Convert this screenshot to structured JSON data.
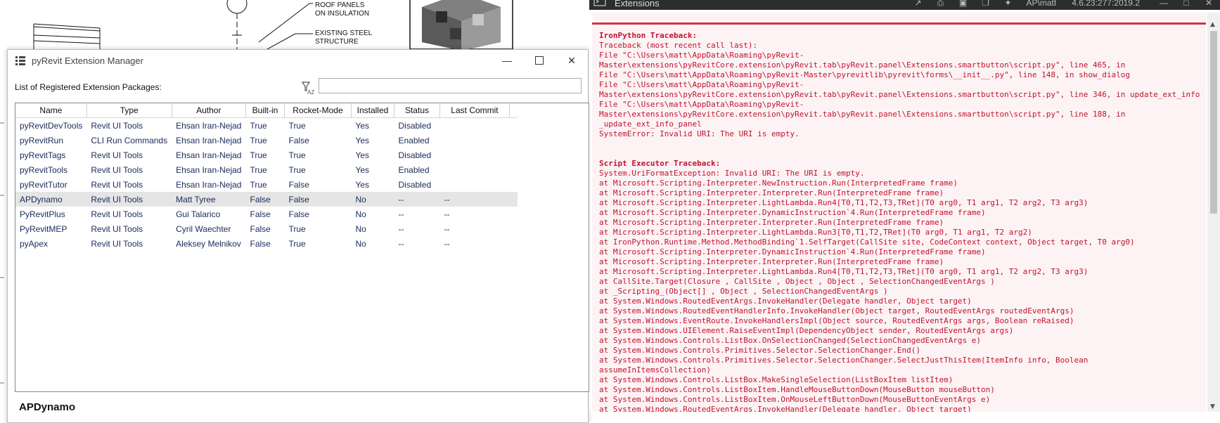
{
  "cad": {
    "label_roof_1": "ROOF PANELS",
    "label_roof_2": "ON INSULATION",
    "label_steel_1": "EXISTING STEEL",
    "label_steel_2": "STRUCTURE"
  },
  "manager": {
    "title": "pyRevit Extension Manager",
    "list_label": "List of Registered Extension Packages:",
    "search_value": "",
    "columns": [
      "Name",
      "Type",
      "Author",
      "Built-in",
      "Rocket-Mode",
      "Installed",
      "Status",
      "Last Commit"
    ],
    "rows": [
      {
        "name": "pyRevitDevTools",
        "type": "Revit UI Tools",
        "author": "Ehsan Iran-Nejad",
        "builtin": "True",
        "rocket": "True",
        "installed": "Yes",
        "status": "Disabled",
        "commit": ""
      },
      {
        "name": "pyRevitRun",
        "type": "CLI Run Commands",
        "author": "Ehsan Iran-Nejad",
        "builtin": "True",
        "rocket": "False",
        "installed": "Yes",
        "status": "Enabled",
        "commit": ""
      },
      {
        "name": "pyRevitTags",
        "type": "Revit UI Tools",
        "author": "Ehsan Iran-Nejad",
        "builtin": "True",
        "rocket": "True",
        "installed": "Yes",
        "status": "Disabled",
        "commit": ""
      },
      {
        "name": "pyRevitTools",
        "type": "Revit UI Tools",
        "author": "Ehsan Iran-Nejad",
        "builtin": "True",
        "rocket": "True",
        "installed": "Yes",
        "status": "Enabled",
        "commit": ""
      },
      {
        "name": "pyRevitTutor",
        "type": "Revit UI Tools",
        "author": "Ehsan Iran-Nejad",
        "builtin": "True",
        "rocket": "False",
        "installed": "Yes",
        "status": "Disabled",
        "commit": ""
      },
      {
        "name": "APDynamo",
        "type": "Revit UI Tools",
        "author": "Matt Tyree",
        "builtin": "False",
        "rocket": "False",
        "installed": "No",
        "status": "--",
        "commit": "--",
        "selected": true
      },
      {
        "name": "PyRevitPlus",
        "type": "Revit UI Tools",
        "author": "Gui Talarico",
        "builtin": "False",
        "rocket": "False",
        "installed": "No",
        "status": "--",
        "commit": "--"
      },
      {
        "name": "PyRevitMEP",
        "type": "Revit UI Tools",
        "author": "Cyril Waechter",
        "builtin": "False",
        "rocket": "True",
        "installed": "No",
        "status": "--",
        "commit": "--"
      },
      {
        "name": "pyApex",
        "type": "Revit UI Tools",
        "author": "Aleksey Melnikov",
        "builtin": "False",
        "rocket": "True",
        "installed": "No",
        "status": "--",
        "commit": "--"
      }
    ],
    "detail_title": "APDynamo"
  },
  "output": {
    "title": "Extensions",
    "user": "AP\\matt",
    "version": "4.6.23:277:2019.2",
    "lines": [
      {
        "text": "IronPython Traceback:",
        "bold": true
      },
      {
        "text": "Traceback (most recent call last):"
      },
      {
        "text": "File \"C:\\Users\\matt\\AppData\\Roaming\\pyRevit-"
      },
      {
        "text": "Master\\extensions\\pyRevitCore.extension\\pyRevit.tab\\pyRevit.panel\\Extensions.smartbutton\\script.py\", line 465, in"
      },
      {
        "text": "File \"C:\\Users\\matt\\AppData\\Roaming\\pyRevit-Master\\pyrevitlib\\pyrevit\\forms\\__init__.py\", line 148, in show_dialog"
      },
      {
        "text": "File \"C:\\Users\\matt\\AppData\\Roaming\\pyRevit-"
      },
      {
        "text": "Master\\extensions\\pyRevitCore.extension\\pyRevit.tab\\pyRevit.panel\\Extensions.smartbutton\\script.py\", line 346, in update_ext_info"
      },
      {
        "text": "File \"C:\\Users\\matt\\AppData\\Roaming\\pyRevit-"
      },
      {
        "text": "Master\\extensions\\pyRevitCore.extension\\pyRevit.tab\\pyRevit.panel\\Extensions.smartbutton\\script.py\", line 188, in"
      },
      {
        "text": "_update_ext_info_panel"
      },
      {
        "text": "SystemError: Invalid URI: The URI is empty."
      },
      {
        "text": ""
      },
      {
        "text": ""
      },
      {
        "text": "Script Executor Traceback:",
        "bold": true
      },
      {
        "text": "System.UriFormatException: Invalid URI: The URI is empty."
      },
      {
        "text": "at Microsoft.Scripting.Interpreter.NewInstruction.Run(InterpretedFrame frame)"
      },
      {
        "text": "at Microsoft.Scripting.Interpreter.Interpreter.Run(InterpretedFrame frame)"
      },
      {
        "text": "at Microsoft.Scripting.Interpreter.LightLambda.Run4[T0,T1,T2,T3,TRet](T0 arg0, T1 arg1, T2 arg2, T3 arg3)"
      },
      {
        "text": "at Microsoft.Scripting.Interpreter.DynamicInstruction`4.Run(InterpretedFrame frame)"
      },
      {
        "text": "at Microsoft.Scripting.Interpreter.Interpreter.Run(InterpretedFrame frame)"
      },
      {
        "text": "at Microsoft.Scripting.Interpreter.LightLambda.Run3[T0,T1,T2,TRet](T0 arg0, T1 arg1, T2 arg2)"
      },
      {
        "text": "at IronPython.Runtime.Method.MethodBinding`1.SelfTarget(CallSite site, CodeContext context, Object target, T0 arg0)"
      },
      {
        "text": "at Microsoft.Scripting.Interpreter.DynamicInstruction`4.Run(InterpretedFrame frame)"
      },
      {
        "text": "at Microsoft.Scripting.Interpreter.Interpreter.Run(InterpretedFrame frame)"
      },
      {
        "text": "at Microsoft.Scripting.Interpreter.LightLambda.Run4[T0,T1,T2,T3,TRet](T0 arg0, T1 arg1, T2 arg2, T3 arg3)"
      },
      {
        "text": "at CallSite.Target(Closure , CallSite , Object , Object , SelectionChangedEventArgs )"
      },
      {
        "text": "at _Scripting_(Object[] , Object , SelectionChangedEventArgs )"
      },
      {
        "text": "at System.Windows.RoutedEventArgs.InvokeHandler(Delegate handler, Object target)"
      },
      {
        "text": "at System.Windows.RoutedEventHandlerInfo.InvokeHandler(Object target, RoutedEventArgs routedEventArgs)"
      },
      {
        "text": "at System.Windows.EventRoute.InvokeHandlersImpl(Object source, RoutedEventArgs args, Boolean reRaised)"
      },
      {
        "text": "at System.Windows.UIElement.RaiseEventImpl(DependencyObject sender, RoutedEventArgs args)"
      },
      {
        "text": "at System.Windows.Controls.ListBox.OnSelectionChanged(SelectionChangedEventArgs e)"
      },
      {
        "text": "at System.Windows.Controls.Primitives.Selector.SelectionChanger.End()"
      },
      {
        "text": "at System.Windows.Controls.Primitives.Selector.SelectionChanger.SelectJustThisItem(ItemInfo info, Boolean"
      },
      {
        "text": "assumeInItemsCollection)"
      },
      {
        "text": "at System.Windows.Controls.ListBox.MakeSingleSelection(ListBoxItem listItem)"
      },
      {
        "text": "at System.Windows.Controls.ListBoxItem.HandleMouseButtonDown(MouseButton mouseButton)"
      },
      {
        "text": "at System.Windows.Controls.ListBoxItem.OnMouseLeftButtonDown(MouseButtonEventArgs e)"
      },
      {
        "text": "at System.Windows.RoutedEventArgs.InvokeHandler(Delegate handler, Object target)"
      }
    ]
  }
}
